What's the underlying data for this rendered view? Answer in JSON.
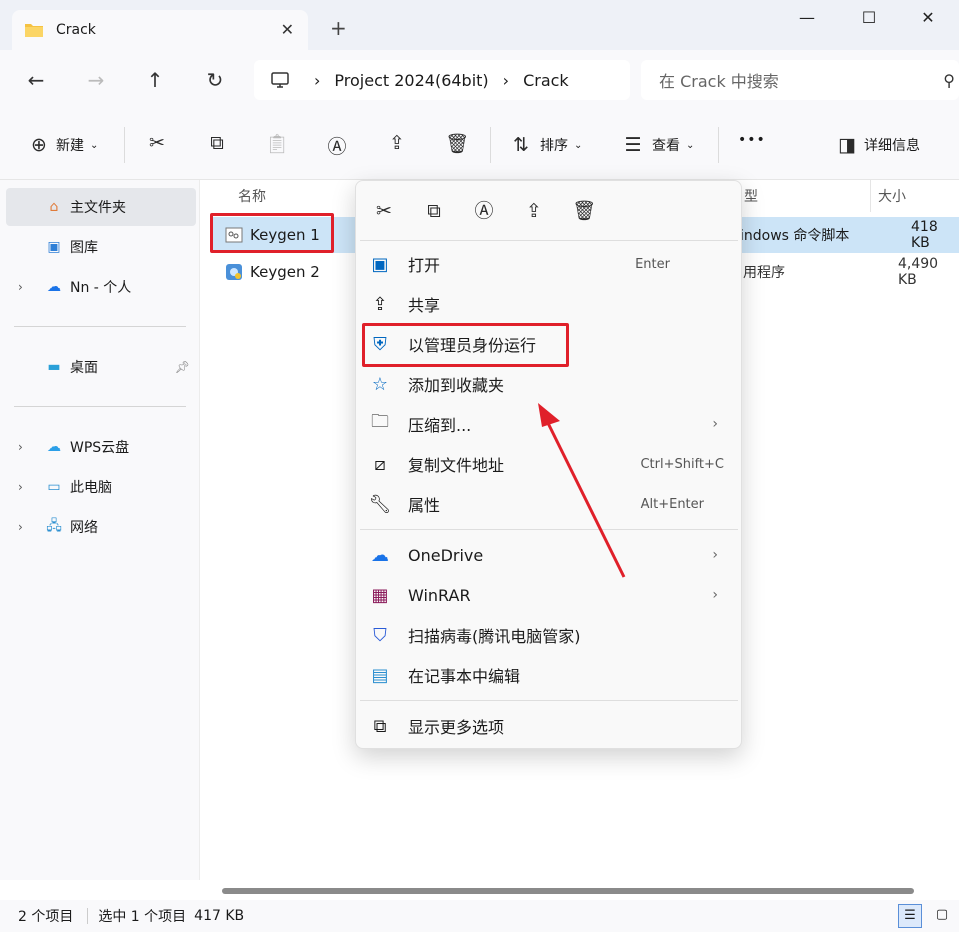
{
  "window": {
    "tab_title": "Crack",
    "new_tab_symbol": "+",
    "close_tab_symbol": "✕",
    "minimize_symbol": "—",
    "maximize_symbol": "☐",
    "close_symbol": "✕"
  },
  "address": {
    "crumbs": [
      "Project 2024(64bit)",
      "Crack"
    ],
    "search_placeholder": "在 Crack 中搜索"
  },
  "toolbar": {
    "new_label": "新建",
    "sort_label": "排序",
    "view_label": "查看",
    "more_label": "•••",
    "details_label": "详细信息"
  },
  "sidebar": {
    "items": [
      {
        "label": "主文件夹",
        "icon": "home-icon"
      },
      {
        "label": "图库",
        "icon": "gallery-icon"
      },
      {
        "label": "Nn - 个人",
        "icon": "onedrive-icon"
      },
      {
        "label": "桌面",
        "icon": "desktop-icon"
      },
      {
        "label": "WPS云盘",
        "icon": "cloud-icon"
      },
      {
        "label": "此电脑",
        "icon": "pc-icon"
      },
      {
        "label": "网络",
        "icon": "network-icon"
      }
    ]
  },
  "filelist": {
    "columns": [
      "名称",
      "型",
      "大小"
    ],
    "rows": [
      {
        "name": "Keygen 1",
        "type": "indows 命令脚本",
        "size": "418 KB"
      },
      {
        "name": "Keygen 2",
        "type": "用程序",
        "size": "4,490 KB"
      }
    ]
  },
  "context_menu": {
    "items": [
      {
        "label": "打开",
        "shortcut": "Enter",
        "icon": "open-icon"
      },
      {
        "label": "共享",
        "shortcut": "",
        "icon": "share-icon"
      },
      {
        "label": "以管理员身份运行",
        "shortcut": "",
        "icon": "admin-shield-icon"
      },
      {
        "label": "添加到收藏夹",
        "shortcut": "",
        "icon": "star-icon"
      },
      {
        "label": "压缩到...",
        "shortcut": "",
        "icon": "zip-folder-icon"
      },
      {
        "label": "复制文件地址",
        "shortcut": "Ctrl+Shift+C",
        "icon": "copy-path-icon"
      },
      {
        "label": "属性",
        "shortcut": "Alt+Enter",
        "icon": "wrench-icon"
      },
      {
        "label": "OneDrive",
        "shortcut": "",
        "icon": "onedrive-icon"
      },
      {
        "label": "WinRAR",
        "shortcut": "",
        "icon": "winrar-icon"
      },
      {
        "label": "扫描病毒(腾讯电脑管家)",
        "shortcut": "",
        "icon": "shield-scan-icon"
      },
      {
        "label": "在记事本中编辑",
        "shortcut": "",
        "icon": "notepad-icon"
      },
      {
        "label": "显示更多选项",
        "shortcut": "",
        "icon": "more-options-icon"
      }
    ]
  },
  "status": {
    "count": "2 个项目",
    "selection": "选中 1 个项目",
    "size": "417 KB"
  },
  "colors": {
    "highlight_red": "#e0202a",
    "selection_bg": "#cce4f7",
    "accent_blue": "#0067c0"
  }
}
